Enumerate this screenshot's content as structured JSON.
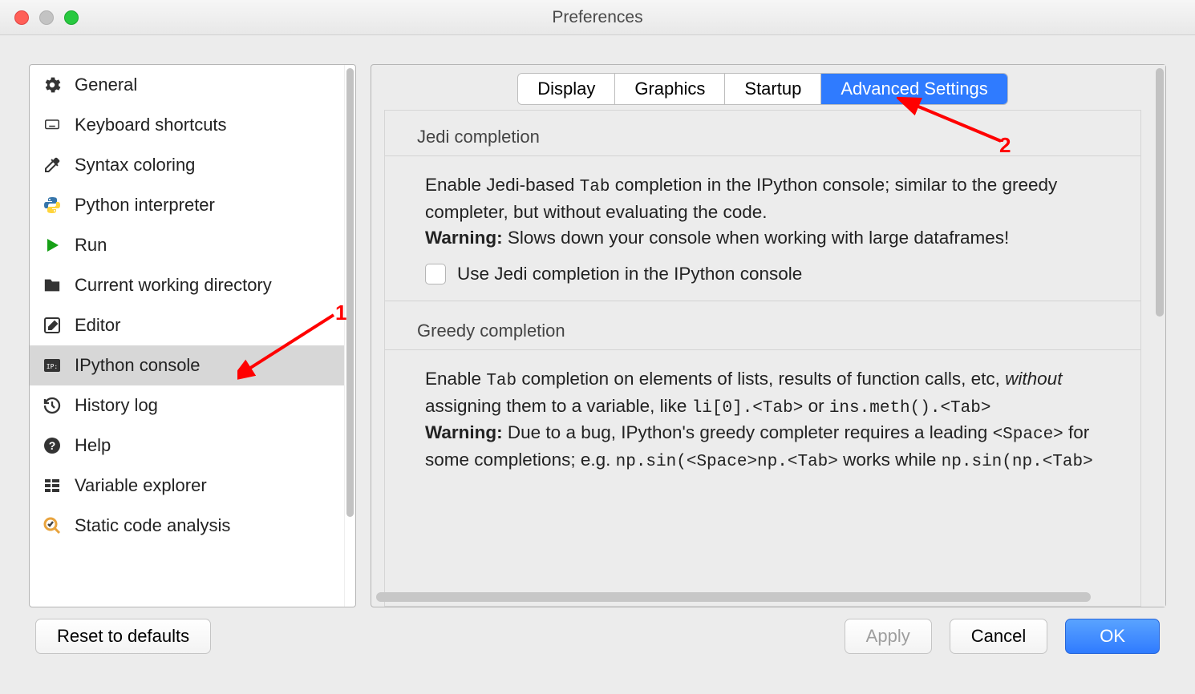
{
  "window": {
    "title": "Preferences"
  },
  "sidebar": {
    "items": [
      {
        "label": "General",
        "icon": "gears"
      },
      {
        "label": "Keyboard shortcuts",
        "icon": "keyboard"
      },
      {
        "label": "Syntax coloring",
        "icon": "eyedropper"
      },
      {
        "label": "Python interpreter",
        "icon": "python"
      },
      {
        "label": "Run",
        "icon": "play"
      },
      {
        "label": "Current working directory",
        "icon": "folder"
      },
      {
        "label": "Editor",
        "icon": "edit"
      },
      {
        "label": "IPython console",
        "icon": "ipython",
        "selected": true
      },
      {
        "label": "History log",
        "icon": "history"
      },
      {
        "label": "Help",
        "icon": "help"
      },
      {
        "label": "Variable explorer",
        "icon": "variables"
      },
      {
        "label": "Static code analysis",
        "icon": "analysis"
      }
    ]
  },
  "tabs": [
    {
      "label": "Display"
    },
    {
      "label": "Graphics"
    },
    {
      "label": "Startup"
    },
    {
      "label": "Advanced Settings",
      "active": true
    }
  ],
  "sections": {
    "jedi": {
      "title": "Jedi completion",
      "desc_pre": "Enable Jedi-based ",
      "desc_tab": "Tab",
      "desc_mid": " completion in the IPython console; similar to the greedy completer, but without evaluating the code.",
      "warning_label": "Warning:",
      "warning_text": " Slows down your console when working with large dataframes!",
      "checkbox_label": "Use Jedi completion in the IPython console"
    },
    "greedy": {
      "title": "Greedy completion",
      "p1a": "Enable ",
      "p1_tab": "Tab",
      "p1b": " completion on elements of lists, results of function calls, etc, ",
      "p1_without": "without",
      "p1c": " assigning them to a variable, like ",
      "p1_code1": "li[0].<Tab>",
      "p1_or": " or ",
      "p1_code2": "ins.meth().<Tab>",
      "warning_label": "Warning:",
      "w1": " Due to a bug, IPython's greedy completer requires a leading ",
      "w_space": "<Space>",
      "w2": " for some completions; e.g. ",
      "w_code1": "np.sin(<Space>np.<Tab>",
      "w_works": " works while ",
      "w_code2": "np.sin(np.<Tab>"
    }
  },
  "footer": {
    "reset": "Reset to defaults",
    "apply": "Apply",
    "cancel": "Cancel",
    "ok": "OK"
  },
  "annotations": {
    "a1": "1",
    "a2": "2"
  }
}
